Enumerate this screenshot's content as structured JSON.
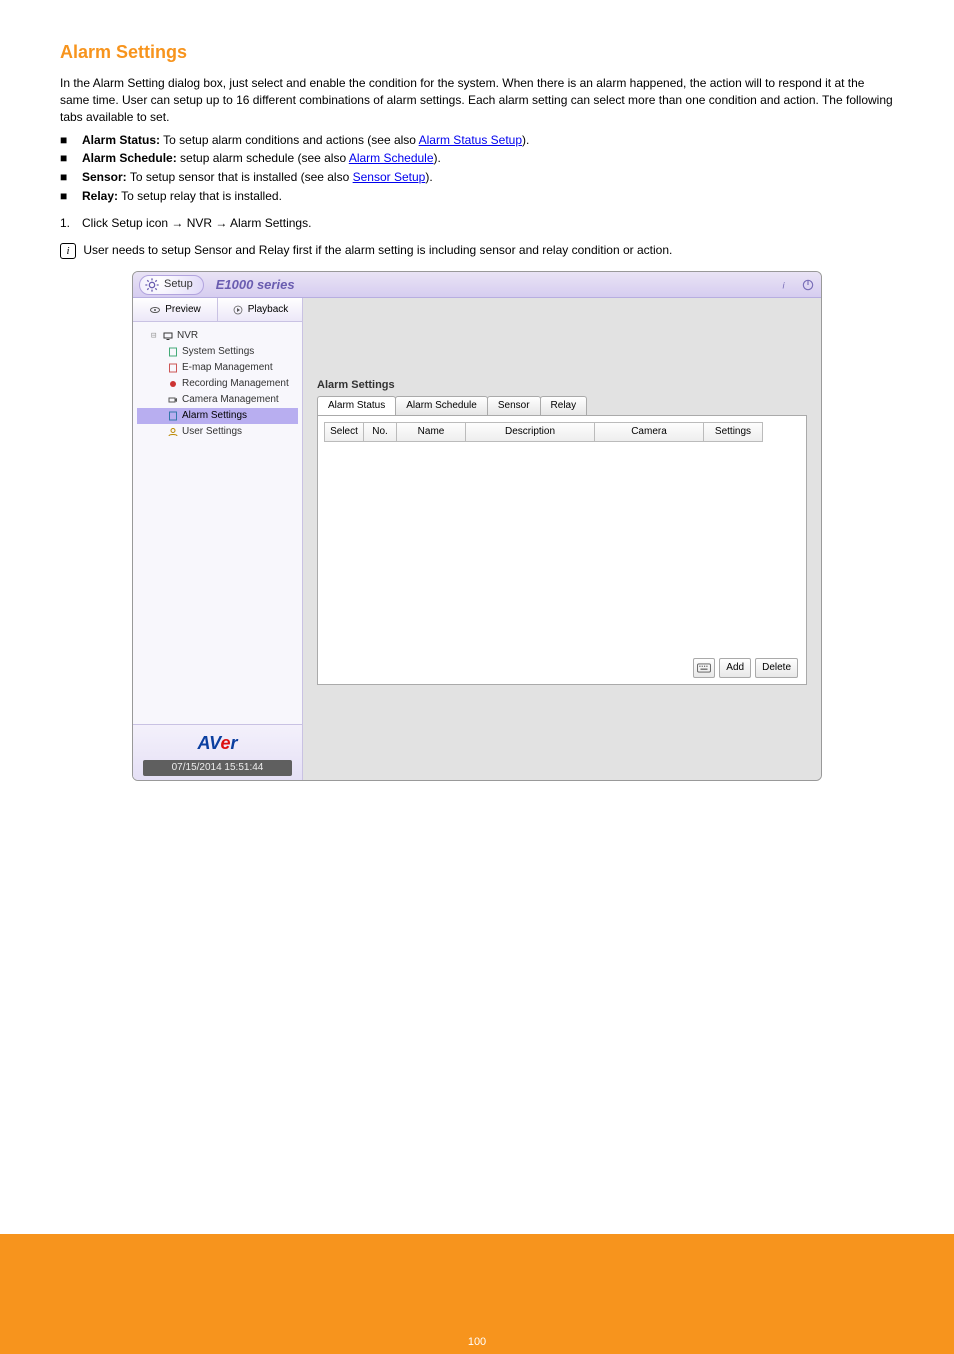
{
  "heading": "Alarm Settings",
  "intro": "In the Alarm Setting dialog box, just select and enable the condition for the system. When there is an alarm happened, the action will to respond it at the same time. User can setup up to 16 different combinations of alarm settings. Each alarm setting can select more than one condition and action. The following tabs available to set.",
  "bullets": [
    {
      "label": "Alarm Status:",
      "text": "To setup alarm conditions and actions (see also ",
      "linkText": "Alarm Status Setup",
      "tail": ")."
    },
    {
      "label": "Alarm Schedule:",
      "text": "setup alarm schedule (see also ",
      "linkText": "Alarm Schedule",
      "tail": ")."
    },
    {
      "label": "Sensor:",
      "text": "To setup sensor that is installed (see also ",
      "linkText": "Sensor Setup",
      "tail": ")."
    },
    {
      "label": "Relay:",
      "text": "To setup relay that is installed."
    }
  ],
  "bulletGlyph": "■",
  "numlist": {
    "num": "1.",
    "text": "Click Setup icon → NVR → Alarm Settings."
  },
  "note": "User needs to setup Sensor and Relay first if the alarm setting is including sensor and relay condition or action.",
  "shot": {
    "setup_label": "Setup",
    "model": "E1000 series",
    "side_tabs": {
      "preview": "Preview",
      "playback": "Playback"
    },
    "tree": {
      "root": "NVR",
      "items": [
        "System Settings",
        "E-map Management",
        "Recording Management",
        "Camera Management",
        "Alarm Settings",
        "User Settings"
      ],
      "selected_index": 4
    },
    "timestamp": "07/15/2014 15:51:44",
    "pane_title": "Alarm Settings",
    "pane_tabs": [
      "Alarm Status",
      "Alarm Schedule",
      "Sensor",
      "Relay"
    ],
    "grid_headers": {
      "select": "Select",
      "no": "No.",
      "name": "Name",
      "description": "Description",
      "camera": "Camera",
      "settings": "Settings"
    },
    "footer_buttons": {
      "add": "Add",
      "delete": "Delete"
    }
  },
  "page_number": "100"
}
